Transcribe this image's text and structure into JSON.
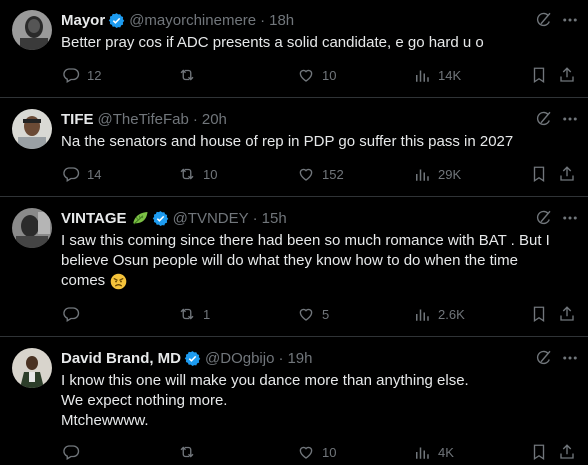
{
  "colors": {
    "background": "#000000",
    "text": "#e7e9ea",
    "muted": "#71767b",
    "verified": "#1d9bf0",
    "divider": "#2f3336"
  },
  "tweets": [
    {
      "name": "Mayor",
      "handle": "@mayorchinemere",
      "time": "18h",
      "lines": [
        "Better pray cos if ADC presents a solid candidate, e go hard u o"
      ],
      "replies": "12",
      "retweets": "",
      "likes": "10",
      "views": "14K"
    },
    {
      "name": "TIFE",
      "handle": "@TheTifeFab",
      "time": "20h",
      "lines": [
        "Na the senators and house of rep in PDP go suffer this pass in 2027"
      ],
      "replies": "14",
      "retweets": "10",
      "likes": "152",
      "views": "29K"
    },
    {
      "name": "VINTAGE",
      "name_badge": "leaf-emoji",
      "handle": "@TVNDEY",
      "time": "15h",
      "lines": [
        "I saw this coming since there had been so much romance with BAT . But I",
        "believe Osun people will do what they know how to do when the time",
        "comes"
      ],
      "end_emoji": "angry-face-emoji",
      "replies": "",
      "retweets": "1",
      "likes": "5",
      "views": "2.6K"
    },
    {
      "name": "David Brand, MD",
      "handle": "@DOgbijo",
      "time": "19h",
      "lines": [
        "I know this one will make you dance more than anything else.",
        "We expect nothing more.",
        "Mtchewwww."
      ],
      "replies": "",
      "retweets": "",
      "likes": "10",
      "views": "4K"
    }
  ],
  "separator": "·"
}
